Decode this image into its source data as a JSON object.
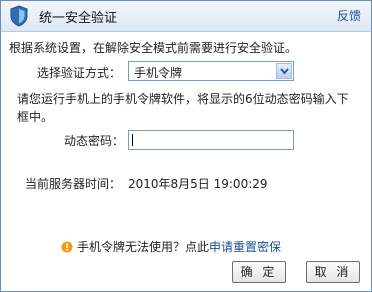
{
  "dialog": {
    "title": "统一安全验证",
    "feedback_link": "反馈",
    "description": "根据系统设置，在解除安全模式前需要进行安全验证。"
  },
  "form": {
    "method_label": "选择验证方式：",
    "method_value": "手机令牌",
    "instruction": "请您运行手机上的手机令牌软件，将显示的6位动态密码输入下框中。",
    "password_label": "动态密码：",
    "password_value": "",
    "server_time_label": "当前服务器时间：",
    "server_time_value": "2010年8月5日 19:00:29"
  },
  "help": {
    "text": "手机令牌无法使用？点此",
    "link": "申请重置密保"
  },
  "buttons": {
    "ok": "确 定",
    "cancel": "取 消"
  },
  "colors": {
    "accent": "#1a4f95",
    "border": "#6e8fb3",
    "info_icon": "#f39c12"
  },
  "icons": {
    "title": "shield-icon",
    "dropdown": "chevron-down-icon",
    "help": "info-icon"
  }
}
